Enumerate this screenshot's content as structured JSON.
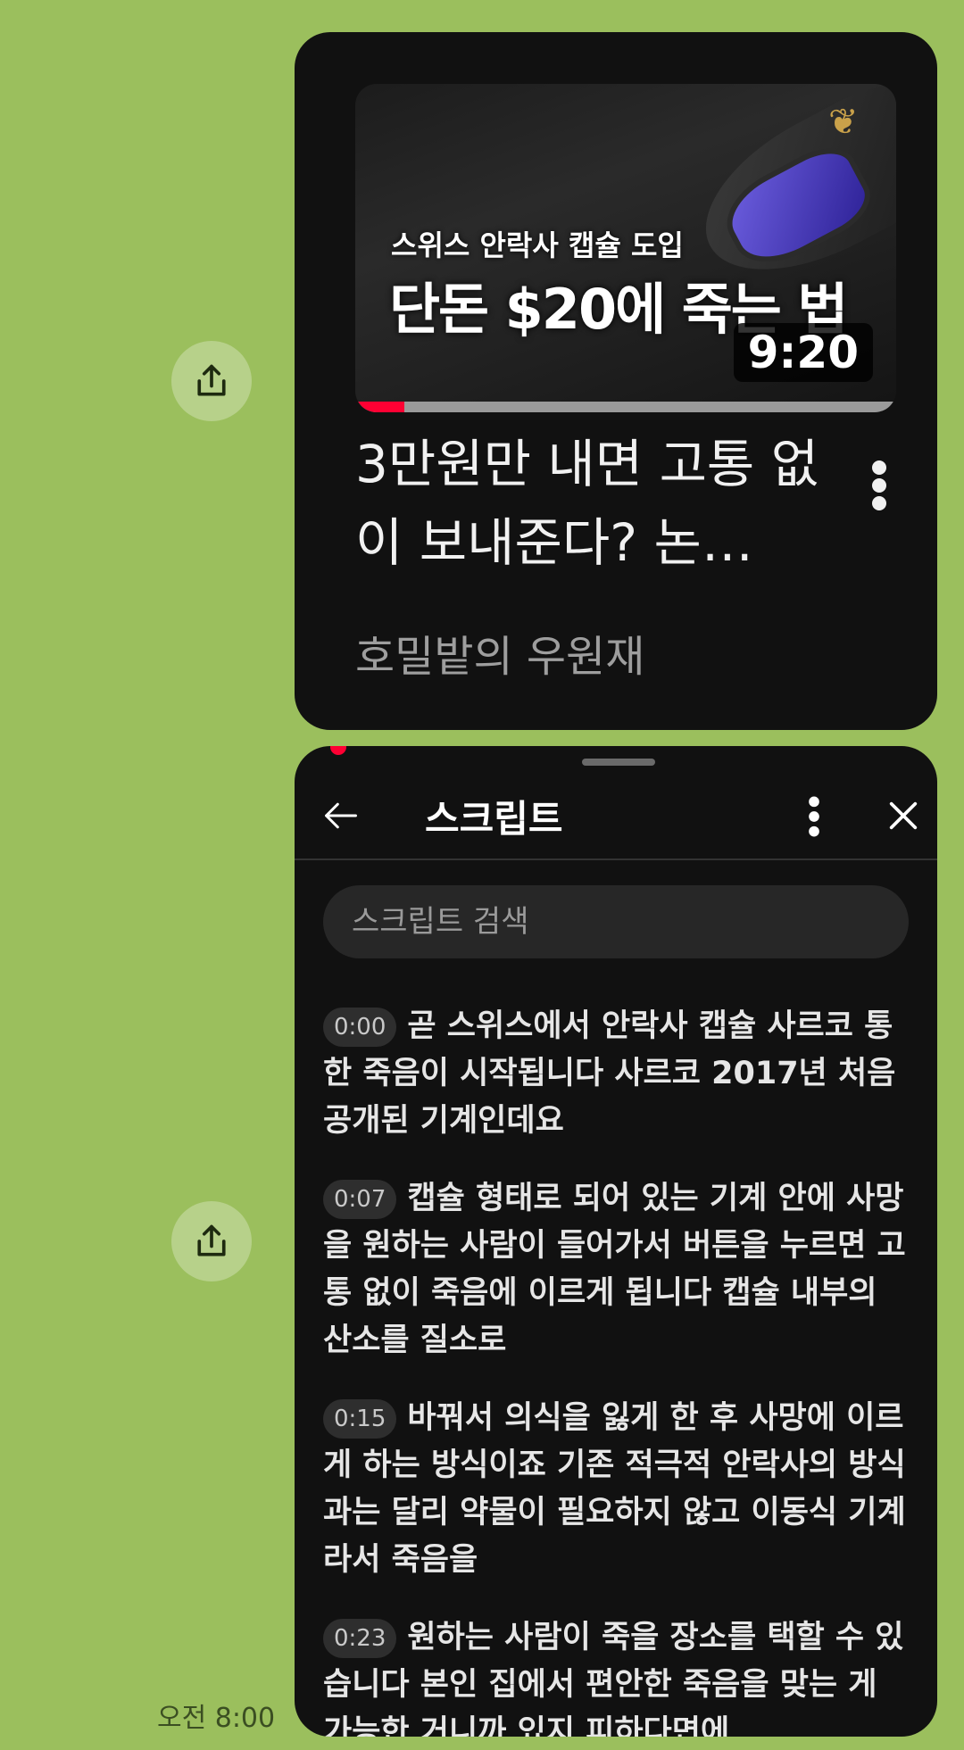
{
  "video_card": {
    "thumbnail": {
      "subtitle_text": "스위스 안락사 캡슐 도입",
      "headline_text": "단돈 $20에 죽는 법",
      "duration": "9:20",
      "watched_fraction": 0.09
    },
    "title": "3만원만 내면 고통 없이 보내준다? 논…",
    "channel": "호밀밭의 우원재"
  },
  "transcript_panel": {
    "title": "스크립트",
    "search_placeholder": "스크립트 검색",
    "segments": [
      {
        "time": "0:00",
        "text": "곧 스위스에서 안락사 캡슐 사르코 통한 죽음이 시작됩니다 사르코 2017년 처음 공개된 기계인데요"
      },
      {
        "time": "0:07",
        "text": "캡슐 형태로 되어 있는 기계 안에 사망을 원하는 사람이 들어가서 버튼을 누르면 고통 없이 죽음에 이르게 됩니다 캡슐 내부의 산소를 질소로"
      },
      {
        "time": "0:15",
        "text": "바꿔서 의식을 잃게 한 후 사망에 이르게 하는 방식이죠 기존 적극적 안락사의 방식과는 달리 약물이 필요하지 않고 이동식 기계라서 죽음을"
      },
      {
        "time": "0:23",
        "text": "원하는 사람이 죽을 장소를 택할 수 있습니다 본인 집에서 편안한 죽음을 맞는 게 가능한 거니까 있지 피하다면에"
      }
    ]
  },
  "message_time": "오전 8:00",
  "colors": {
    "chat_background": "#9bbf5d",
    "card_background": "#111111",
    "progress_red": "#ff0033"
  }
}
